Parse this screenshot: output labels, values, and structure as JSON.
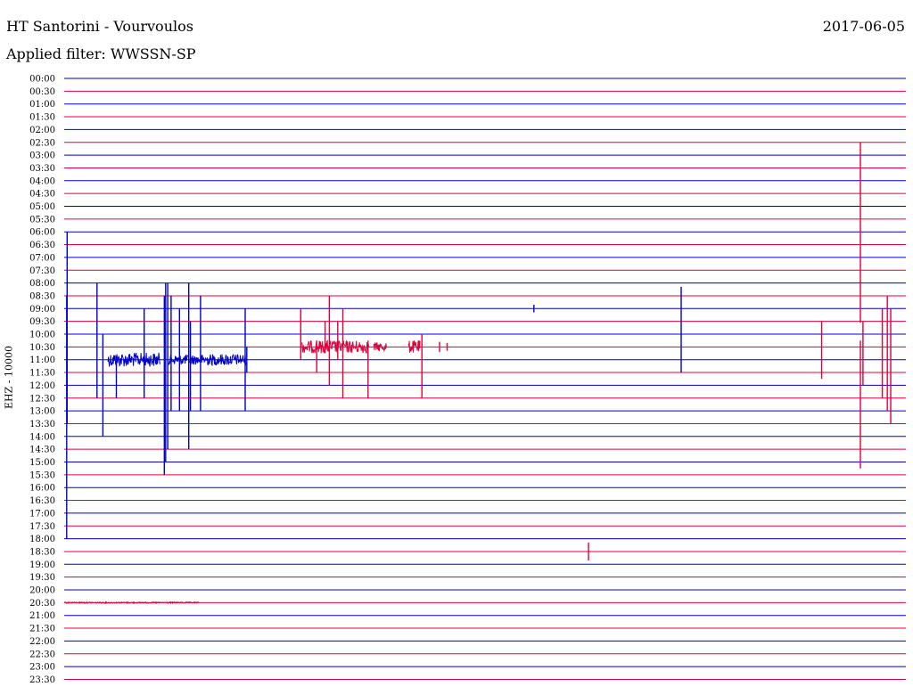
{
  "header": {
    "station": "HT Santorini - Vourvoulos",
    "date": "2017-06-05",
    "filter": "Applied filter: WWSSN-SP"
  },
  "chart_data": {
    "type": "line",
    "title": "HT Santorini - Vourvoulos",
    "subtitle": "Applied filter: WWSSN-SP",
    "ylabel": "EHZ - 10000",
    "row_labels": [
      "00:00",
      "00:30",
      "01:00",
      "01:30",
      "02:00",
      "02:30",
      "03:00",
      "03:30",
      "04:00",
      "04:30",
      "05:00",
      "05:30",
      "06:00",
      "06:30",
      "07:00",
      "07:30",
      "08:00",
      "08:30",
      "09:00",
      "09:30",
      "10:00",
      "10:30",
      "11:00",
      "11:30",
      "12:00",
      "12:30",
      "13:00",
      "13:30",
      "14:00",
      "14:30",
      "15:00",
      "15:30",
      "16:00",
      "16:30",
      "17:00",
      "17:30",
      "18:00",
      "18:30",
      "19:00",
      "19:30",
      "20:00",
      "20:30",
      "21:00",
      "21:30",
      "22:00",
      "22:30",
      "23:00",
      "23:30"
    ],
    "row_interval_minutes": 30,
    "row_colors": [
      "#0000cc",
      "#e0003c"
    ],
    "series": [
      {
        "color": "#0000cc",
        "row": "11:00",
        "noise_segments": [
          [
            0.052,
            0.114,
            0.55
          ],
          [
            0.124,
            0.169,
            0.4
          ],
          [
            0.169,
            0.217,
            0.45
          ]
        ],
        "spikes": [
          [
            0.003,
            5,
            14
          ],
          [
            0.0035,
            10,
            5
          ],
          [
            0.039,
            6,
            3
          ],
          [
            0.046,
            2,
            6
          ],
          [
            0.062,
            0.3,
            3
          ],
          [
            0.095,
            4,
            3
          ],
          [
            0.119,
            5,
            9
          ],
          [
            0.1205,
            6,
            8
          ],
          [
            0.123,
            6,
            7
          ],
          [
            0.127,
            5,
            4
          ],
          [
            0.137,
            4,
            4
          ],
          [
            0.148,
            6,
            7
          ],
          [
            0.15,
            3,
            4
          ],
          [
            0.162,
            5,
            4
          ],
          [
            0.215,
            4,
            4
          ],
          [
            0.217,
            1,
            1
          ]
        ]
      },
      {
        "color": "#e0003c",
        "row": "10:30",
        "noise_segments": [
          [
            0.282,
            0.362,
            0.5
          ],
          [
            0.368,
            0.383,
            0.35
          ],
          [
            0.409,
            0.423,
            0.5
          ]
        ],
        "spikes": [
          [
            0.281,
            3,
            1
          ],
          [
            0.3,
            0.5,
            2
          ],
          [
            0.31,
            2,
            0.5
          ],
          [
            0.315,
            4,
            3
          ],
          [
            0.325,
            2,
            1
          ],
          [
            0.331,
            3,
            4
          ],
          [
            0.361,
            0.5,
            4
          ],
          [
            0.425,
            1,
            4
          ],
          [
            0.446,
            0.4,
            0.4
          ],
          [
            0.455,
            0.3,
            0.3
          ],
          [
            0.9,
            2,
            2.5
          ],
          [
            0.946,
            0.5,
            9.5
          ],
          [
            0.949,
            2,
            3
          ],
          [
            0.972,
            3,
            4
          ],
          [
            0.978,
            4,
            5
          ],
          [
            0.982,
            3,
            6
          ]
        ]
      },
      {
        "color": "#0000cc",
        "row": "09:00",
        "spikes": [
          [
            0.558,
            0.3,
            0.3
          ],
          [
            0.733,
            1.7,
            5
          ]
        ]
      },
      {
        "color": "#e0003c",
        "row": "02:30",
        "spikes": [
          [
            0.946,
            0,
            14.1
          ]
        ]
      },
      {
        "color": "#e0003c",
        "row": "18:30",
        "spikes": [
          [
            0.623,
            0.7,
            0.7
          ]
        ]
      },
      {
        "color": "#e0003c",
        "row": "20:30",
        "noise_segments": [
          [
            0.0,
            0.16,
            0.05
          ]
        ]
      }
    ]
  }
}
